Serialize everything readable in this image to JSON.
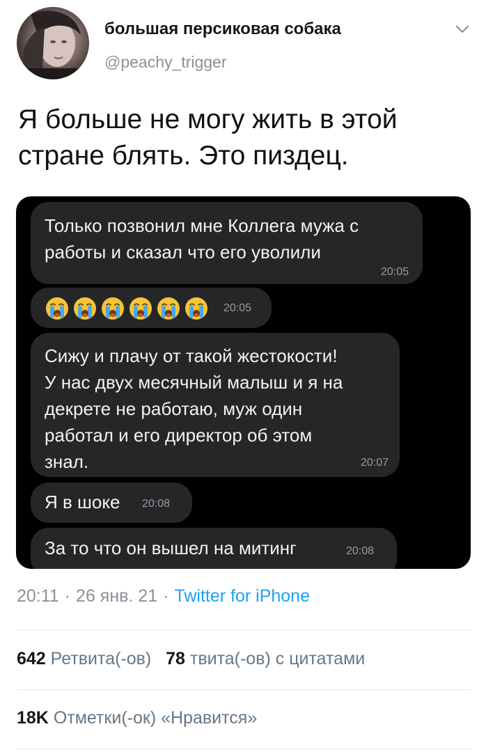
{
  "author": {
    "display_name": "большая персиковая собака",
    "handle": "@peachy_trigger"
  },
  "tweet": {
    "text": "Я больше не могу жить в этой стране блять. Это пиздец."
  },
  "chat": {
    "messages": [
      {
        "text": "Только позвонил мне Коллега мужа с\nработы и сказал что его уволили",
        "time": "20:05"
      },
      {
        "emoji": [
          "loudly-crying-face",
          "loudly-crying-face",
          "loudly-crying-face",
          "loudly-crying-face",
          "loudly-crying-face",
          "loudly-crying-face"
        ],
        "time": "20:05"
      },
      {
        "text": "Сижу и плачу от такой жестокости!\nУ нас двух месячный малыш и я на\nдекрете не работаю, муж один\nработал и  его директор об этом\nзнал.",
        "time": "20:07"
      },
      {
        "text": "Я в шоке",
        "time": "20:08"
      },
      {
        "text": "За то что он вышел на митинг",
        "time": "20:08"
      }
    ]
  },
  "meta": {
    "time": "20:11",
    "separator": "·",
    "date": "26 янв. 21",
    "source": "Twitter for iPhone"
  },
  "stats": {
    "retweets_count": "642",
    "retweets_label": "Ретвита(-ов)",
    "quotes_count": "78",
    "quotes_label": "твита(-ов) с цитатами",
    "likes_count": "18K",
    "likes_label": "Отметки(-ок) «Нравится»"
  },
  "icons": {
    "menu": "chevron-down-icon",
    "emoji": "loudly-crying-face-icon"
  },
  "colors": {
    "link": "#1da1f2",
    "muted": "#8a9199",
    "bubble": "#262629",
    "media_bg": "#000000"
  }
}
